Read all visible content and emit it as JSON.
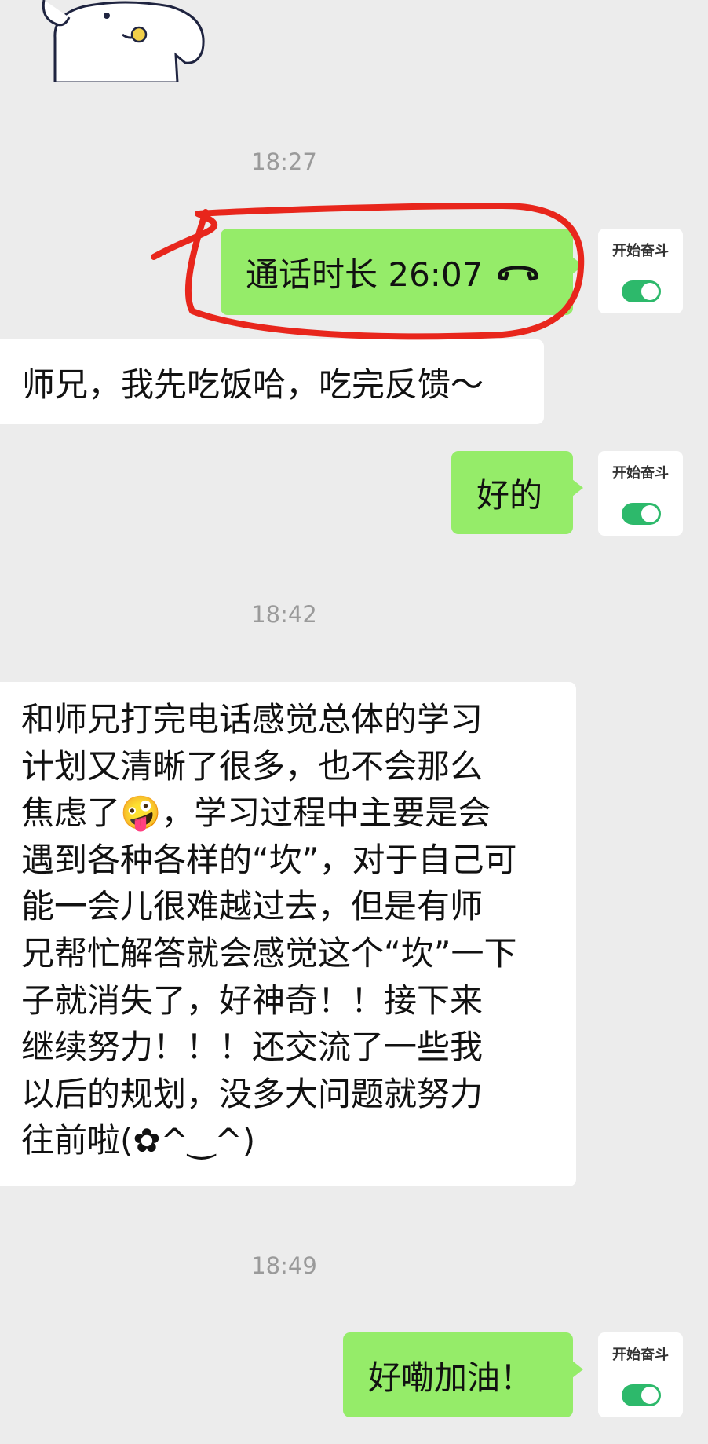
{
  "chat": {
    "timestamps": [
      "18:27",
      "18:42",
      "18:49"
    ],
    "messages": {
      "call": {
        "text": "通话时长 26:07",
        "icon": "phone-hangup-icon"
      },
      "m1": "师兄，我先吃饭哈，吃完反馈～",
      "m2": "好的",
      "m3": "和师兄打完电话感觉总体的学习\n计划又清晰了很多，也不会那么\n焦虑了🤪，学习过程中主要是会\n遇到各种各样的“坎”，对于自己可\n能一会儿很难越过去，但是有师\n兄帮忙解答就会感觉这个“坎”一下\n子就消失了，好神奇！！接下来\n继续努力！！！还交流了一些我\n以后的规划，没多大问题就努力\n往前啦(✿^‿^)",
      "m4": "好嘞加油！"
    },
    "avatar_label": "开始奋斗"
  },
  "colors": {
    "background": "#ececec",
    "outgoing_bubble": "#95ec69",
    "incoming_bubble": "#ffffff",
    "toggle_on": "#2db96b",
    "annotation": "#e8261c"
  }
}
